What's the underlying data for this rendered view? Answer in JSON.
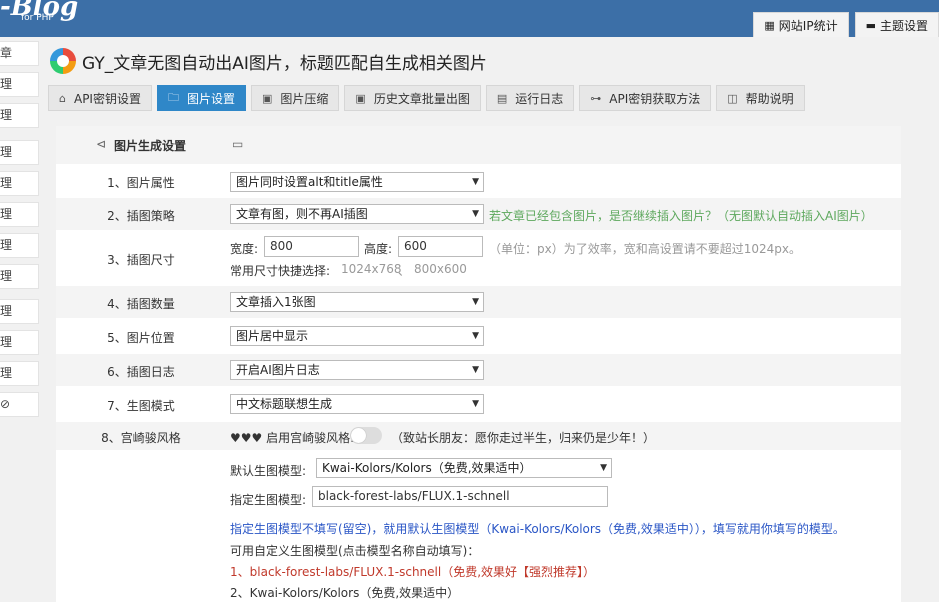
{
  "header": {
    "logo_text": "-Blog",
    "logo_sub": "for PHP",
    "tabs": [
      {
        "label": "网站IP统计",
        "icon": "document-icon"
      },
      {
        "label": "主题设置",
        "icon": "window-icon"
      }
    ]
  },
  "sidebar": {
    "items": [
      "章",
      "理",
      "理",
      "理",
      "理",
      "理",
      "理",
      "理",
      "理",
      "理",
      "理",
      "⊘"
    ]
  },
  "plugin": {
    "title": "GY_文章无图自动出AI图片，标题匹配自生成相关图片"
  },
  "nav": {
    "tabs": [
      {
        "label": "API密钥设置",
        "icon": "home-icon"
      },
      {
        "label": "图片设置",
        "icon": "folder-icon"
      },
      {
        "label": "图片压缩",
        "icon": "image-icon"
      },
      {
        "label": "历史文章批量出图",
        "icon": "image-icon"
      },
      {
        "label": "运行日志",
        "icon": "log-icon"
      },
      {
        "label": "API密钥获取方法",
        "icon": "key-icon"
      },
      {
        "label": "帮助说明",
        "icon": "help-icon"
      }
    ]
  },
  "section": {
    "title": "图片生成设置"
  },
  "settings": {
    "alt": {
      "label": "1、图片属性",
      "value": "图片同时设置alt和title属性"
    },
    "strategy": {
      "label": "2、插图策略",
      "value": "文章有图，则不再AI插图",
      "hint": "若文章已经包含图片，是否继续插入图片？（无图默认自动插入AI图片）"
    },
    "size": {
      "label": "3、插图尺寸",
      "width_label": "宽度:",
      "width": "800",
      "height_label": "高度:",
      "height": "600",
      "hint": "（单位：px）为了效率，宽和高设置请不要超过1024px。",
      "quick_label": "常用尺寸快捷选择:",
      "quick1": "1024x768",
      "sep": "、",
      "quick2": "800x600"
    },
    "count": {
      "label": "4、插图数量",
      "value": "文章插入1张图"
    },
    "position": {
      "label": "5、图片位置",
      "value": "图片居中显示"
    },
    "log": {
      "label": "6、插图日志",
      "value": "开启AI图片日志"
    },
    "mode": {
      "label": "7、生图模式",
      "value": "中文标题联想生成"
    },
    "ghibli": {
      "label": "8、宫崎骏风格",
      "toggle_label": "♥♥♥ 启用宫崎骏风格:",
      "hint": "（致站长朋友：愿你走过半生，归来仍是少年！）"
    },
    "model": {
      "default_label": "默认生图模型:",
      "default_value": "Kwai-Kolors/Kolors（免费,效果适中）",
      "custom_label": "指定生图模型:",
      "custom_value": "black-forest-labs/FLUX.1-schnell",
      "note": "指定生图模型不填写(留空)，就用默认生图模型（Kwai-Kolors/Kolors（免费,效果适中）），填写就用你填写的模型。",
      "list_title": "可用自定义生图模型(点击模型名称自动填写)：",
      "item1": "1、black-forest-labs/FLUX.1-schnell（免费,效果好【强烈推荐】）",
      "item2": "2、Kwai-Kolors/Kolors（免费,效果适中）"
    }
  }
}
